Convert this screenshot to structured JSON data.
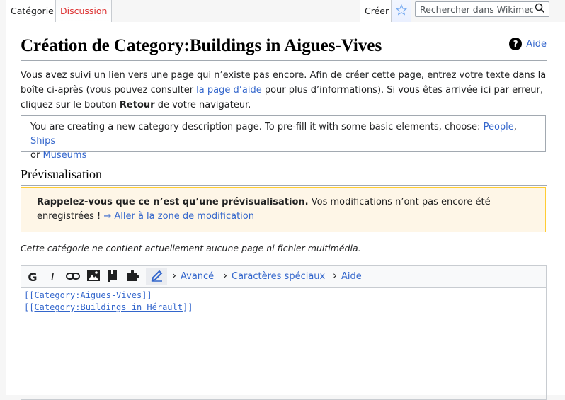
{
  "tabs": {
    "category": "Catégorie",
    "discussion": "Discussion",
    "create": "Créer"
  },
  "search": {
    "placeholder": "Rechercher dans Wikimedia"
  },
  "page": {
    "title": "Création de Category:Buildings in Aigues-Vives",
    "help_label": "Aide",
    "help_glyph": "?"
  },
  "intro": {
    "part1": "Vous avez suivi un lien vers une page qui n’existe pas encore. Afin de créer cette page, entrez votre texte dans la boîte ci-après (vous pouvez consulter ",
    "link": "la page d’aide",
    "part2": " pour plus d’informations). Si vous êtes arrivée ici par erreur, cliquez sur le bouton ",
    "bold": "Retour",
    "part3": " de votre navigateur."
  },
  "notice": {
    "text": "You are creating a new category description page. To pre-fill it with some basic elements, choose: ",
    "people": "People",
    "comma": ",",
    "ships": "Ships",
    "or": "or",
    "museums": "Museums"
  },
  "preview": {
    "heading": "Prévisualisation",
    "warn_bold": "Rappelez-vous que ce n’est qu’une prévisualisation.",
    "warn_text": " Vos modifications n’ont pas encore été enregistrées ! ",
    "warn_link": "→ Aller à la zone de modification",
    "empty_note": "Cette catégorie ne contient actuellement aucune page ni fichier multimédia."
  },
  "toolbar": {
    "bold": "G",
    "italic": "I",
    "advanced": "Avancé",
    "special_chars": "Caractères spéciaux",
    "help": "Aide"
  },
  "editor": {
    "line1_open": "[[",
    "line1_ns": "Category:",
    "line1_name": "Aigues-Vives",
    "line1_close": "]]",
    "line2_open": "[[",
    "line2_a": "Category:Buildings in ",
    "line2_b": "Hérault",
    "line2_close": "]]"
  },
  "colors": {
    "link": "#3366cc",
    "redlink": "#dd3333",
    "warning_bg": "#fef6e7",
    "warning_border": "#ffcc33"
  }
}
